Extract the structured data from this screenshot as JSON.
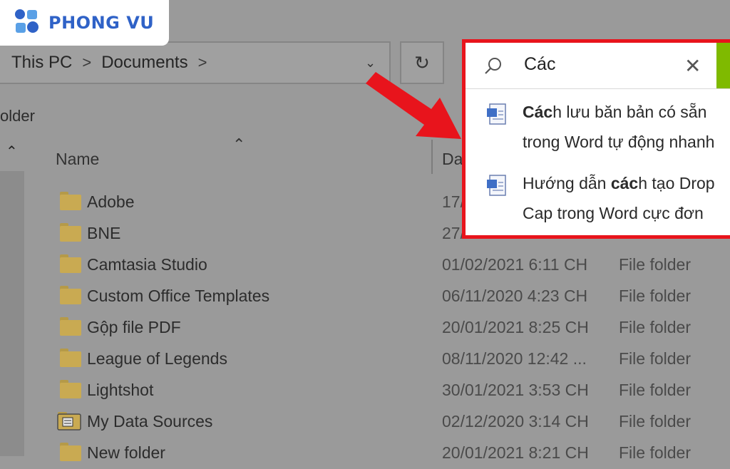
{
  "logo": {
    "text": "PHONG VU",
    "color": "#2f62c7"
  },
  "address_bar": {
    "crumbs": [
      "This PC",
      "Documents"
    ],
    "separator": ">",
    "dropdown_icon": "chevron-down-icon",
    "refresh_icon": "refresh-icon"
  },
  "toolbar": {
    "label": "older"
  },
  "columns": {
    "name": "Name",
    "date": "Da"
  },
  "rows": [
    {
      "name": "Adobe",
      "date": "17/",
      "type": ""
    },
    {
      "name": "BNE",
      "date": "27/",
      "type": ""
    },
    {
      "name": "Camtasia Studio",
      "date": "01/02/2021 6:11 CH",
      "type": "File folder"
    },
    {
      "name": "Custom Office Templates",
      "date": "06/11/2020 4:23 CH",
      "type": "File folder"
    },
    {
      "name": "Gộp file PDF",
      "date": "20/01/2021 8:25 CH",
      "type": "File folder"
    },
    {
      "name": "League of Legends",
      "date": "08/11/2020 12:42 ...",
      "type": "File folder"
    },
    {
      "name": "Lightshot",
      "date": "30/01/2021 3:53 CH",
      "type": "File folder"
    },
    {
      "name": "My Data Sources",
      "date": "02/12/2020 3:14 CH",
      "type": "File folder"
    },
    {
      "name": "New folder",
      "date": "20/01/2021 8:21 CH",
      "type": "File folder"
    }
  ],
  "search": {
    "query": "Các",
    "suggestions": [
      {
        "bold": "Các",
        "line1_rest": "h lưu băn bản có sẵn",
        "line2": "trong Word tự động nhanh"
      },
      {
        "pre": "Hướng dẫn ",
        "bold": "các",
        "line1_rest": "h tạo Drop",
        "line2": "Cap trong Word cực đơn"
      }
    ]
  },
  "colors": {
    "highlight_border": "#e8141c",
    "arrow": "#e8141c",
    "search_button": "#7fba00",
    "folder": "#c9aa52"
  }
}
